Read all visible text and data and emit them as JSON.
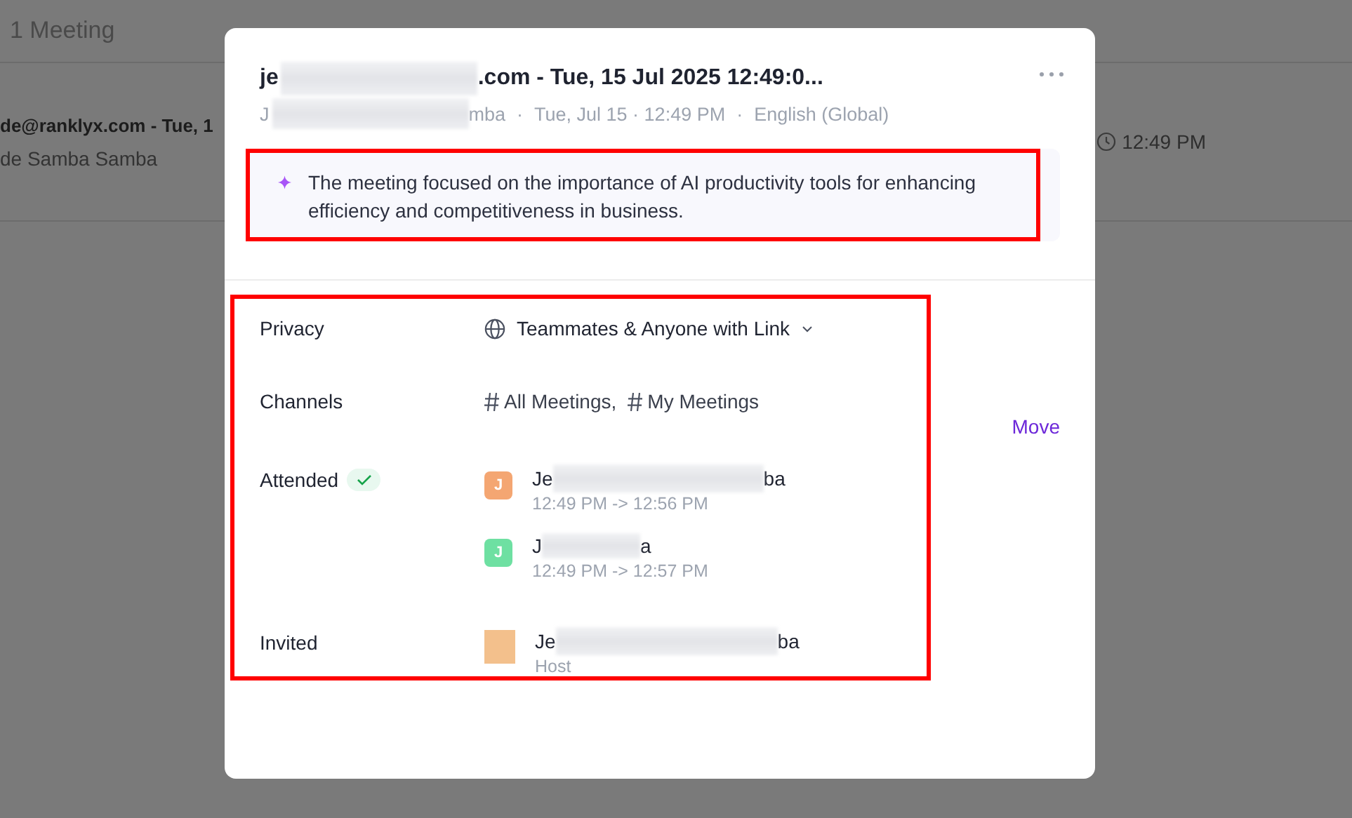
{
  "background": {
    "header": "1 Meeting",
    "row": {
      "title": "de@ranklyx.com - Tue, 1",
      "subtitle": "de Samba Samba",
      "time": "12:49 PM"
    }
  },
  "modal": {
    "title": {
      "start": "je",
      "end": ".com - Tue, 15 Jul 2025 12:49:0..."
    },
    "meta": {
      "start": "J",
      "end": "mba",
      "separator": "·",
      "items": [
        "Tue, Jul 15 · 12:49 PM",
        "English (Global)"
      ]
    },
    "summary": "The meeting focused on the importance of AI productivity tools for enhancing efficiency and competitiveness in business.",
    "details": {
      "privacy": {
        "label": "Privacy",
        "value": "Teammates & Anyone with Link"
      },
      "channels": {
        "label": "Channels",
        "items": [
          "All Meetings",
          "My Meetings"
        ],
        "separator": ",",
        "action": "Move"
      },
      "attended": {
        "label": "Attended",
        "people": [
          {
            "initial": "J",
            "color": "#f4a672",
            "name_start": "Je",
            "name_end": "ba",
            "time": "12:49 PM -> 12:56 PM"
          },
          {
            "initial": "J",
            "color": "#6ee0a2",
            "name_start": "J",
            "name_end": "a",
            "time": "12:49 PM -> 12:57 PM"
          }
        ]
      },
      "invited": {
        "label": "Invited",
        "people": [
          {
            "color": "#f3c08c",
            "name_start": "Je",
            "name_end": "ba",
            "role": "Host"
          }
        ]
      }
    }
  }
}
